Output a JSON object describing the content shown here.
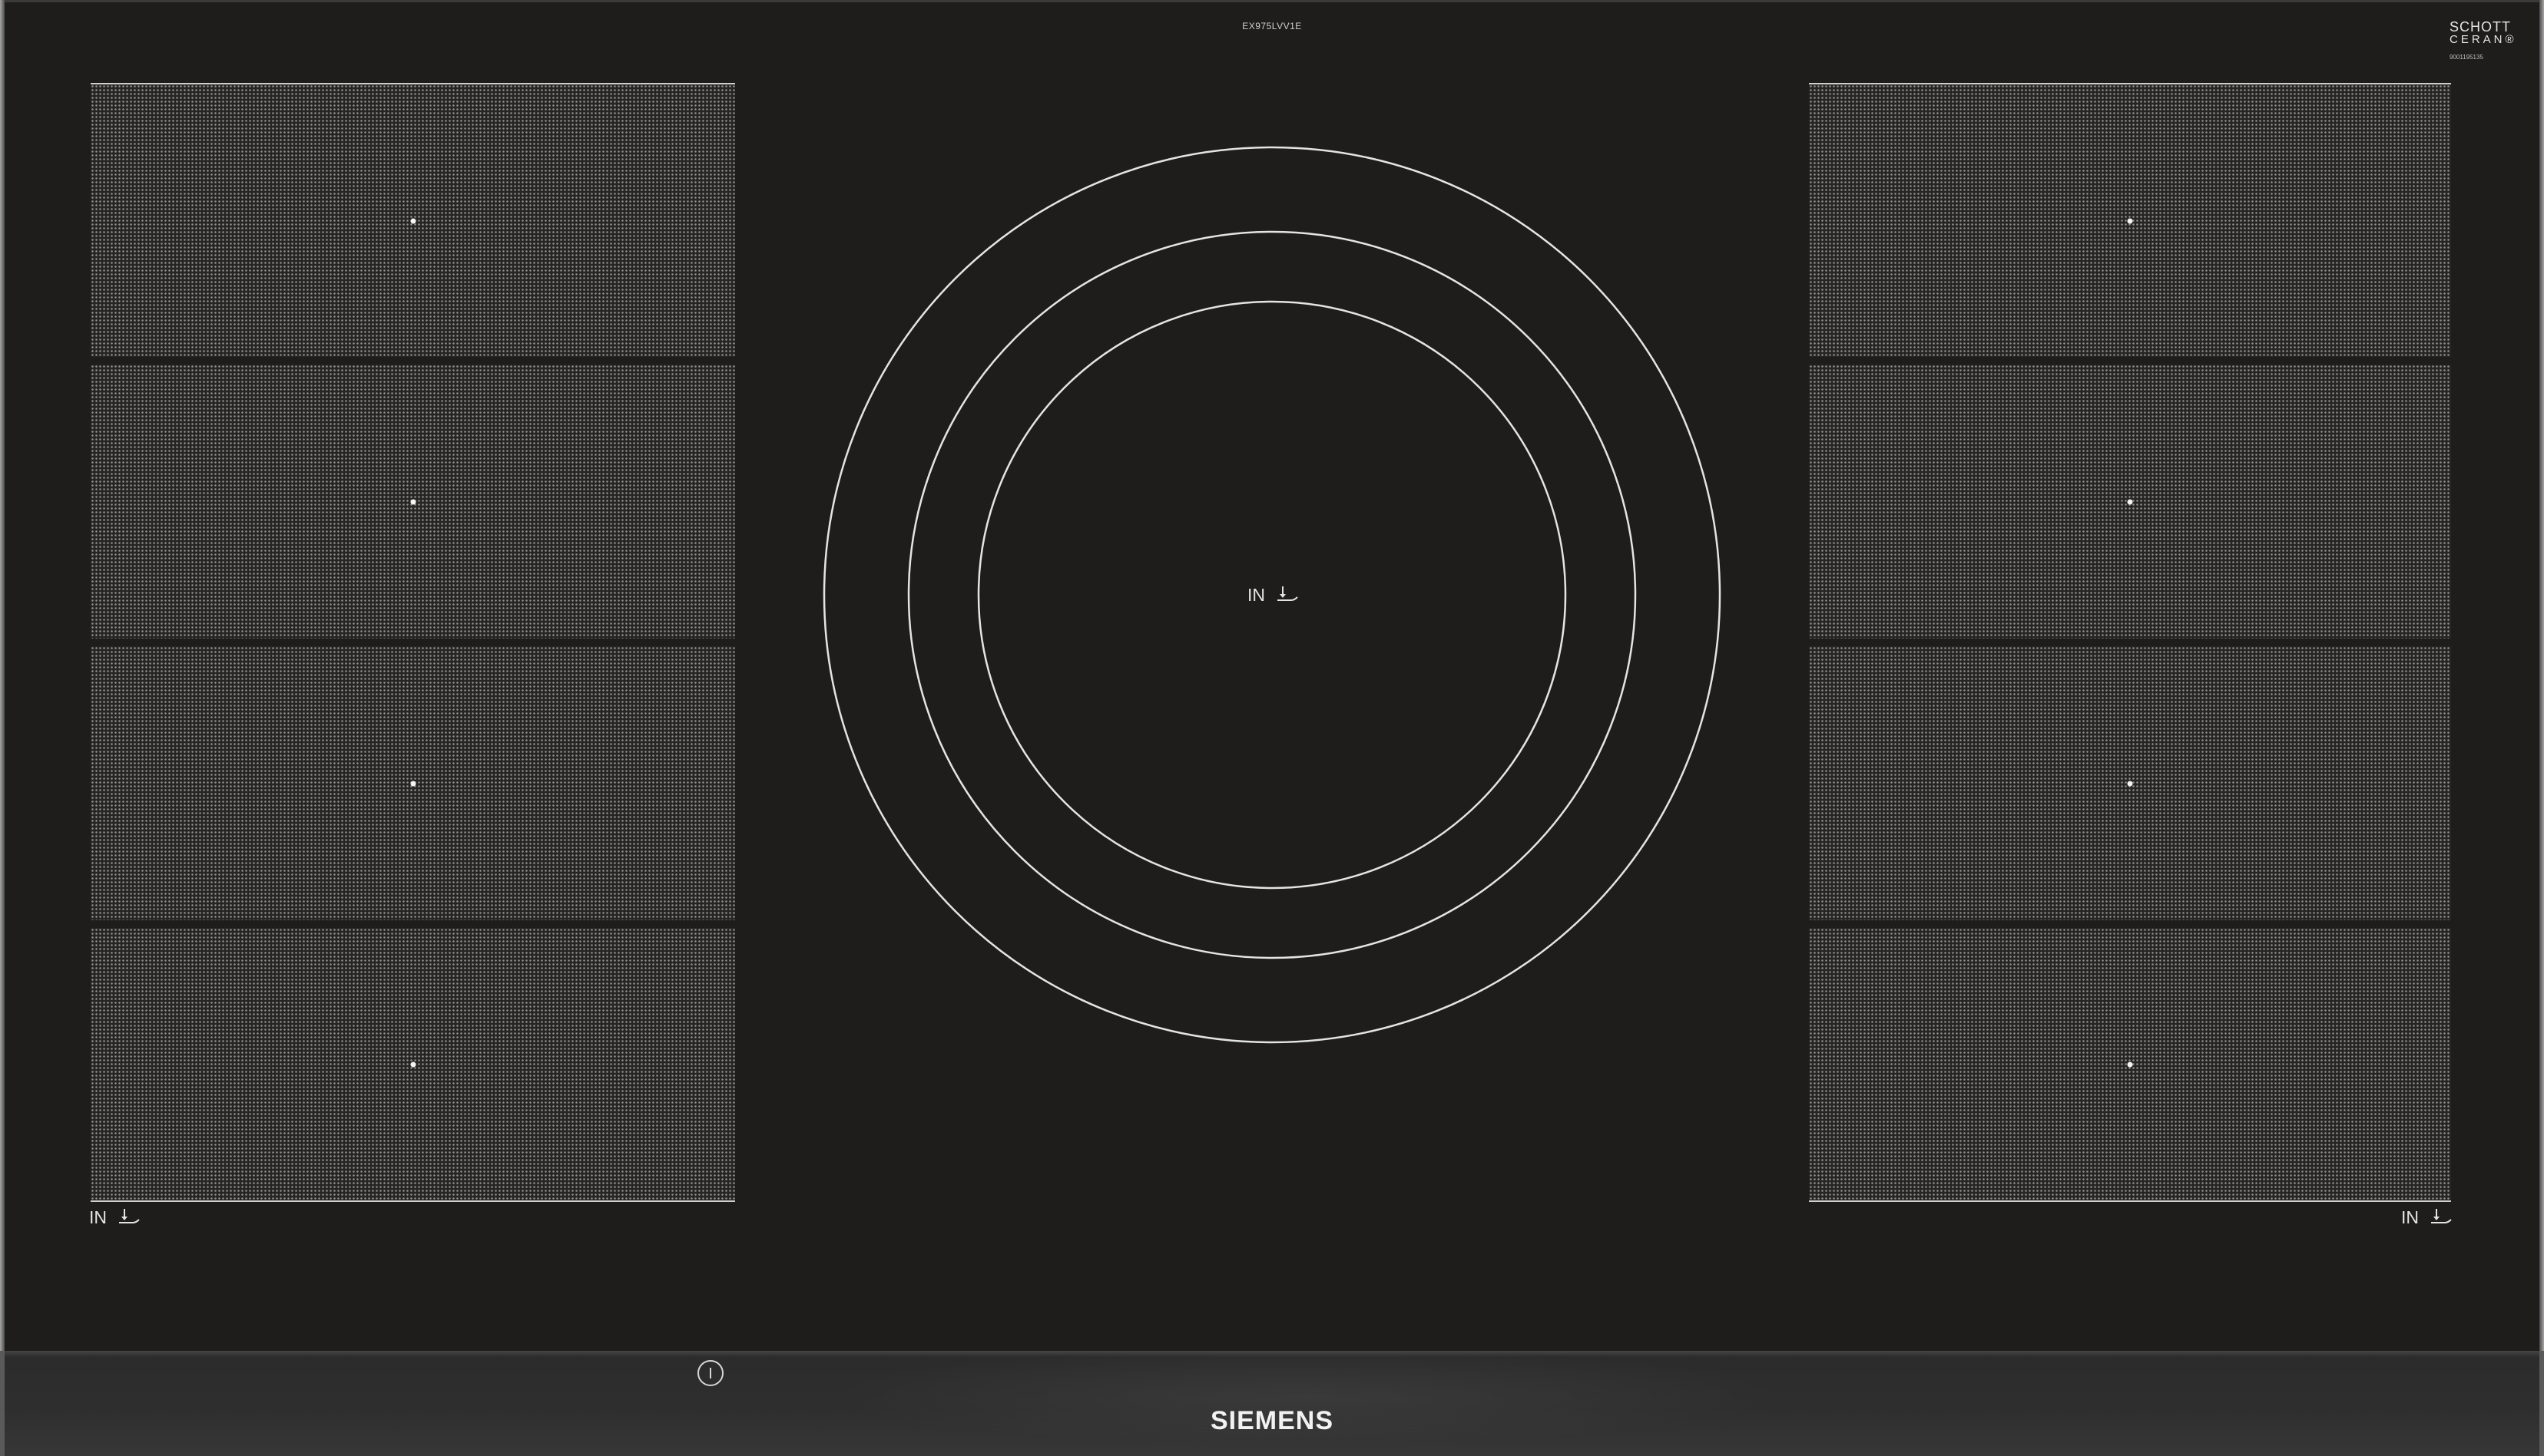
{
  "cooktop": {
    "model_number": "EX975LVV1E",
    "brand_logo": "SIEMENS",
    "glass_logo": {
      "line1": "SCHOTT",
      "line2": "CERAN®",
      "code": "9001195135"
    }
  },
  "markings": {
    "center_zone_label": "IN",
    "left_area_label": "IN",
    "right_area_label": "IN"
  },
  "icons": {
    "induction": "induction-symbol-icon",
    "power": "power-icon"
  },
  "colors": {
    "glass": "#1e1d1c",
    "marking": "#e4e4e4",
    "zone_mesh": "#8c8c8c",
    "control_strip": "#2e2e2e",
    "logo": "#f2f2f2"
  }
}
